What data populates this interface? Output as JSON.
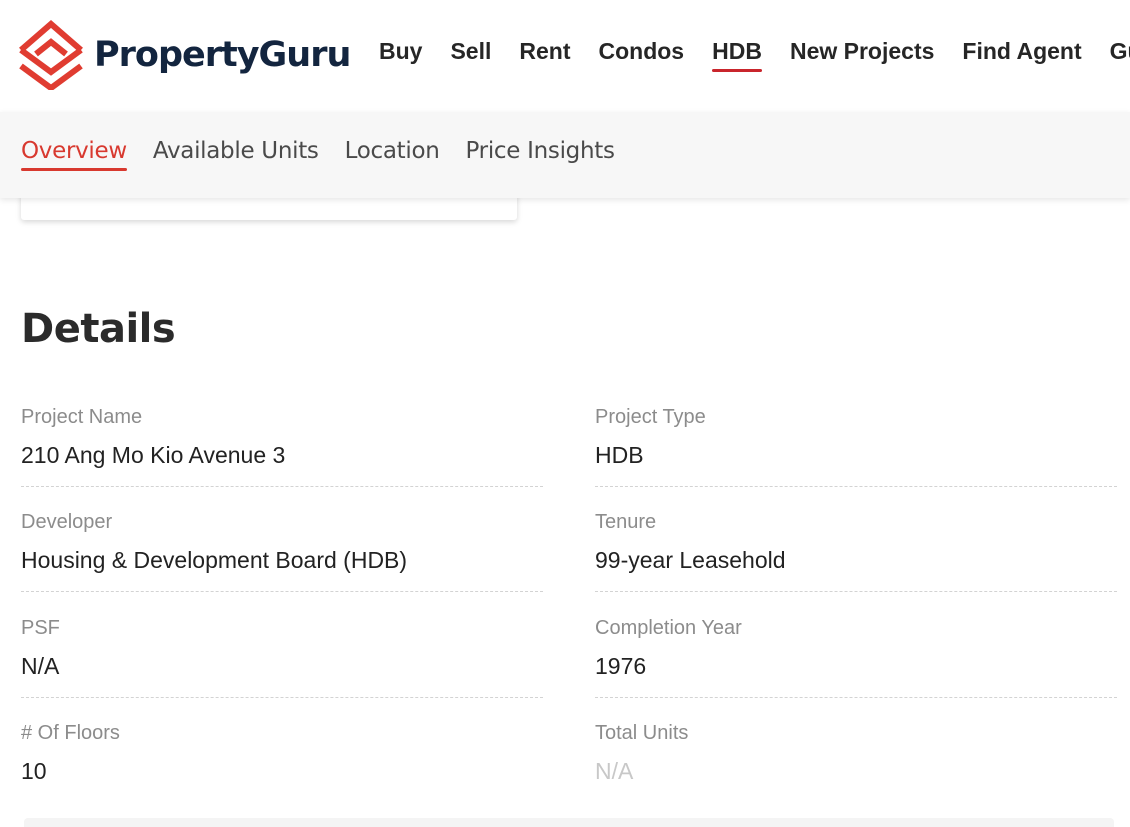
{
  "brand": {
    "name": "PropertyGuru",
    "logo_color": "#e03c31",
    "text_color": "#13253f"
  },
  "nav": {
    "items": [
      {
        "label": "Buy"
      },
      {
        "label": "Sell"
      },
      {
        "label": "Rent"
      },
      {
        "label": "Condos"
      },
      {
        "label": "HDB",
        "active": true
      },
      {
        "label": "New Projects"
      },
      {
        "label": "Find Agent"
      },
      {
        "label": "Guides"
      }
    ]
  },
  "subnav": {
    "items": [
      {
        "label": "Overview",
        "active": true
      },
      {
        "label": "Available Units"
      },
      {
        "label": "Location"
      },
      {
        "label": "Price Insights"
      }
    ],
    "accent_color": "#d8392f"
  },
  "details": {
    "title": "Details",
    "project_name": {
      "label": "Project Name",
      "value": "210 Ang Mo Kio Avenue 3"
    },
    "project_type": {
      "label": "Project Type",
      "value": "HDB"
    },
    "developer": {
      "label": "Developer",
      "value": "Housing & Development Board (HDB)"
    },
    "tenure": {
      "label": "Tenure",
      "value": "99-year Leasehold"
    },
    "psf": {
      "label": "PSF",
      "value": "N/A"
    },
    "completion_year": {
      "label": "Completion Year",
      "value": "1976"
    },
    "floors": {
      "label": "# Of Floors",
      "value": "10"
    },
    "total_units": {
      "label": "Total Units",
      "value": "N/A"
    }
  }
}
